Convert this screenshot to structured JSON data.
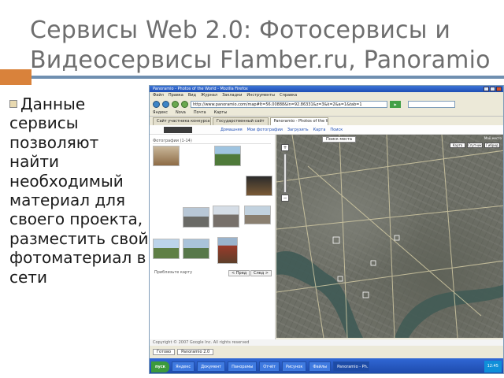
{
  "slide": {
    "title": "Сервисы Web 2.0: Фотосервисы и Видеосервисы Flamber.ru, Panoramio",
    "bullet": "Данные сервисы позволяют найти необходимый материал для своего проекта, разместить свой фотоматериал в сети"
  },
  "colors": {
    "accent_orange": "#d9823b",
    "accent_blue": "#6f8fb0",
    "title_text": "#6e6e6e"
  },
  "browser": {
    "window_title": "Panoramio - Photos of the World - Mozilla Firefox",
    "menu": [
      "Файл",
      "Правка",
      "Вид",
      "Журнал",
      "Закладки",
      "Инструменты",
      "Справка"
    ],
    "address": "http://www.panoramio.com/map#lt=56.00888&ln=92.86331&z=3&k=2&a=1&tab=1",
    "bookmarks": [
      "Яндекс",
      "Nova",
      "Почта",
      "Карты"
    ],
    "tabs": [
      "Сайт участника конкурса",
      "Государственный сайт",
      "Panoramio - Photos of the World"
    ],
    "site_menu": [
      "Домашняя",
      "Мои фотографии",
      "Загрузить",
      "Карта",
      "Поиск"
    ],
    "photo_header": "Фотографии (1-14)",
    "photo_footer": "Приблизьте карту",
    "photo_prev": "< Пред",
    "photo_next": "След >",
    "map_info": "Моё место",
    "map_types": [
      "Карта",
      "Спутник",
      "Гибрид"
    ],
    "search_place": "Поиск места",
    "copyright": "Copyright © 2007 Google Inc. All rights reserved",
    "status_items": [
      "Готово",
      "Panoramio 2.0"
    ],
    "taskbar_items": [
      "Яндекс",
      "Документ",
      "Панорамы",
      "Отчёт",
      "Рисунок",
      "Файлы",
      "Panoramio - Ph..."
    ],
    "start": "пуск",
    "clock": "12:45"
  }
}
